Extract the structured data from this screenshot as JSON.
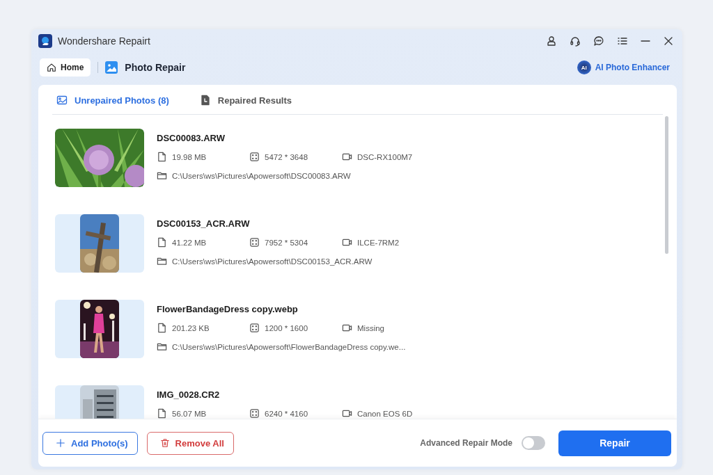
{
  "window": {
    "title": "Wondershare Repairt"
  },
  "nav": {
    "home": "Home",
    "current": "Photo Repair",
    "enhancer": "AI Photo Enhancer",
    "enhancer_badge": "AI"
  },
  "tabs": [
    {
      "label": "Unrepaired Photos (8)",
      "selected": true
    },
    {
      "label": "Repaired Results",
      "selected": false
    }
  ],
  "photos": [
    {
      "name": "DSC00083.ARW",
      "size": "19.98 MB",
      "resolution": "5472 * 3648",
      "camera": "DSC-RX100M7",
      "path": "C:\\Users\\ws\\Pictures\\Apowersoft\\DSC00083.ARW"
    },
    {
      "name": "DSC00153_ACR.ARW",
      "size": "41.22 MB",
      "resolution": "7952 * 5304",
      "camera": "ILCE-7RM2",
      "path": "C:\\Users\\ws\\Pictures\\Apowersoft\\DSC00153_ACR.ARW"
    },
    {
      "name": "FlowerBandageDress copy.webp",
      "size": "201.23 KB",
      "resolution": "1200 * 1600",
      "camera": "Missing",
      "path": "C:\\Users\\ws\\Pictures\\Apowersoft\\FlowerBandageDress copy.we..."
    },
    {
      "name": "IMG_0028.CR2",
      "size": "56.07 MB",
      "resolution": "6240 * 4160",
      "camera": "Canon EOS 6D"
    }
  ],
  "footer": {
    "add": "Add Photo(s)",
    "remove": "Remove All",
    "mode_label": "Advanced Repair Mode",
    "mode_on": false,
    "repair": "Repair"
  }
}
